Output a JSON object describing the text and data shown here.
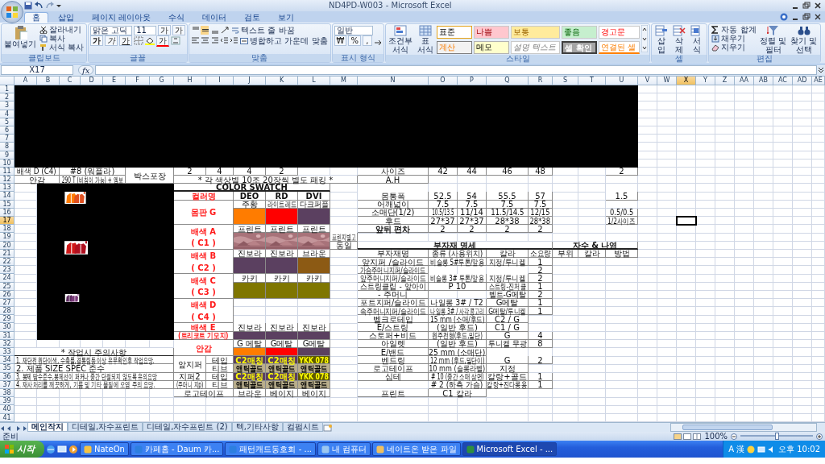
{
  "window": {
    "title": "ND4PD-W003 - Microsoft Excel"
  },
  "ribbon_tabs": [
    {
      "label": "홈",
      "selected": true
    },
    {
      "label": "삽입",
      "selected": false
    },
    {
      "label": "페이지 레이아웃",
      "selected": false
    },
    {
      "label": "수식",
      "selected": false
    },
    {
      "label": "데이터",
      "selected": false
    },
    {
      "label": "검토",
      "selected": false
    },
    {
      "label": "보기",
      "selected": false
    }
  ],
  "clipboard": {
    "paste": "붙여넣기",
    "items": [
      "잘라내기",
      "복사",
      "서식 복사"
    ],
    "label": "클립보드"
  },
  "font": {
    "name": "맑은 고딕",
    "size": "11",
    "grow": "가",
    "shrink": "가",
    "styles": [
      "가",
      "가",
      "가"
    ],
    "color_button": "가",
    "label": "글꼴"
  },
  "alignment": {
    "wrap": "텍스트 줄 바꿈",
    "merge": "병합하고 가운데 맞춤",
    "label": "맞춤"
  },
  "number": {
    "format": "일반",
    "buttons": [
      "₩",
      "%",
      ","
    ],
    "label": "표시 형식"
  },
  "styles": {
    "conditional": "조건부 서식",
    "table": "표 서식",
    "label": "스타일",
    "cells": [
      {
        "text": "표준",
        "kind": "normal"
      },
      {
        "text": "나쁨",
        "kind": "bad"
      },
      {
        "text": "보통",
        "kind": "neutral"
      },
      {
        "text": "좋음",
        "kind": "good"
      },
      {
        "text": "경고문",
        "kind": "warning"
      },
      {
        "text": "계산",
        "kind": "calc"
      },
      {
        "text": "메모",
        "kind": "note"
      },
      {
        "text": "설명 텍스트",
        "kind": "explanatory"
      },
      {
        "text": "셀 확인",
        "kind": "check"
      },
      {
        "text": "연결된 셀",
        "kind": "linked"
      }
    ]
  },
  "cells_group": {
    "buttons": [
      "삽입",
      "삭제",
      "서식"
    ],
    "label": "셀"
  },
  "editing": {
    "items": [
      "자동 합계",
      "채우기",
      "지우기"
    ],
    "big": [
      "정렬 및 필터",
      "찾기 및 선택"
    ],
    "label": "편집"
  },
  "formula_bar": {
    "name_box": "X17",
    "function_label": "fx"
  },
  "columns": [
    {
      "label": "A",
      "selected": false
    },
    {
      "label": "B",
      "selected": false
    },
    {
      "label": "C",
      "selected": false
    },
    {
      "label": "D",
      "selected": false
    },
    {
      "label": "E",
      "selected": false
    },
    {
      "label": "F",
      "selected": false
    },
    {
      "label": "G",
      "selected": false
    },
    {
      "label": "H",
      "selected": false
    },
    {
      "label": "I",
      "selected": false
    },
    {
      "label": "J",
      "selected": false
    },
    {
      "label": "K",
      "selected": false
    },
    {
      "label": "L",
      "selected": false
    },
    {
      "label": "M",
      "selected": false
    },
    {
      "label": "N",
      "selected": false
    },
    {
      "label": "O",
      "selected": false
    },
    {
      "label": "P",
      "selected": false
    },
    {
      "label": "Q",
      "selected": false
    },
    {
      "label": "R",
      "selected": false
    },
    {
      "label": "S",
      "selected": false
    },
    {
      "label": "T",
      "selected": false
    },
    {
      "label": "U",
      "selected": false
    },
    {
      "label": "V",
      "selected": false
    },
    {
      "label": "W",
      "selected": false
    },
    {
      "label": "X",
      "selected": true
    },
    {
      "label": "Y",
      "selected": false
    },
    {
      "label": "Z",
      "selected": false
    },
    {
      "label": "AA",
      "selected": false
    },
    {
      "label": "AB",
      "selected": false
    },
    {
      "label": "AC",
      "selected": false
    },
    {
      "label": "AD",
      "selected": false
    },
    {
      "label": "AE",
      "selected": false
    }
  ],
  "rows": [
    {
      "label": "1",
      "selected": false
    },
    {
      "label": "2",
      "selected": false
    },
    {
      "label": "3",
      "selected": false
    },
    {
      "label": "4",
      "selected": false
    },
    {
      "label": "5",
      "selected": false
    },
    {
      "label": "6",
      "selected": false
    },
    {
      "label": "7",
      "selected": false
    },
    {
      "label": "8",
      "selected": false
    },
    {
      "label": "9",
      "selected": false
    },
    {
      "label": "10",
      "selected": false
    },
    {
      "label": "11",
      "selected": false
    },
    {
      "label": "12",
      "selected": false
    },
    {
      "label": "13",
      "selected": false
    },
    {
      "label": "14",
      "selected": false
    },
    {
      "label": "15",
      "selected": false
    },
    {
      "label": "16",
      "selected": false
    },
    {
      "label": "17",
      "selected": true
    },
    {
      "label": "18",
      "selected": false
    },
    {
      "label": "19",
      "selected": false
    },
    {
      "label": "20",
      "selected": false
    },
    {
      "label": "21",
      "selected": false
    },
    {
      "label": "22",
      "selected": false
    },
    {
      "label": "23",
      "selected": false
    },
    {
      "label": "24",
      "selected": false
    },
    {
      "label": "25",
      "selected": false
    },
    {
      "label": "26",
      "selected": false
    },
    {
      "label": "27",
      "selected": false
    },
    {
      "label": "28",
      "selected": false
    },
    {
      "label": "29",
      "selected": false
    },
    {
      "label": "30",
      "selected": false
    },
    {
      "label": "31",
      "selected": false
    },
    {
      "label": "32",
      "selected": false
    },
    {
      "label": "33",
      "selected": false
    },
    {
      "label": "34",
      "selected": false
    },
    {
      "label": "35",
      "selected": false
    },
    {
      "label": "36",
      "selected": false
    },
    {
      "label": "37",
      "selected": false
    },
    {
      "label": "38",
      "selected": false
    },
    {
      "label": "39",
      "selected": false
    },
    {
      "label": "40",
      "selected": false
    },
    {
      "label": "41",
      "selected": false
    }
  ],
  "sheet": {
    "cells": [
      {
        "text": "배색 D (C4)"
      },
      {
        "text": "#8 (워플라)"
      },
      {
        "text": "박스포장"
      },
      {
        "text": "2"
      },
      {
        "text": "4"
      },
      {
        "text": "4"
      },
      {
        "text": "2"
      },
      {
        "text": "안감"
      },
      {
        "text": "290 T (비침이 가능) + 엠보"
      },
      {
        "text": "* 각 색상별 10조 20장씩 별도 패킹 *"
      },
      {
        "text": "사이즈"
      },
      {
        "text": "42"
      },
      {
        "text": "44"
      },
      {
        "text": "46"
      },
      {
        "text": "48"
      },
      {
        "text": "2"
      },
      {
        "text": "A.H"
      },
      {
        "text": "몸통폭"
      },
      {
        "text": "52.5"
      },
      {
        "text": "54"
      },
      {
        "text": "55.5"
      },
      {
        "text": "57"
      },
      {
        "text": "1.5"
      },
      {
        "text": "어깨넓이"
      },
      {
        "text": "7.5"
      },
      {
        "text": "7.5"
      },
      {
        "text": "7.5"
      },
      {
        "text": "7.5"
      },
      {
        "text": "소매단(1/2)"
      },
      {
        "text": "10.5/13.5"
      },
      {
        "text": "11/14"
      },
      {
        "text": "11.5/14.5"
      },
      {
        "text": "12/15"
      },
      {
        "text": "0.5/0.5"
      },
      {
        "text": "후드"
      },
      {
        "text": "27*37"
      },
      {
        "text": "27*37"
      },
      {
        "text": "28*38"
      },
      {
        "text": "28*38"
      },
      {
        "text": "1/2사이즈"
      },
      {
        "text": "앞뒤 편차"
      },
      {
        "text": "2"
      },
      {
        "text": "2"
      },
      {
        "text": "2"
      },
      {
        "text": "2"
      },
      {
        "text": "COLOR SWATCH"
      },
      {
        "text": "컬러명"
      },
      {
        "text": "DEO"
      },
      {
        "text": "RD"
      },
      {
        "text": "DVI"
      },
      {
        "text": "몸판 G"
      },
      {
        "text": "주황"
      },
      {
        "text": "라이트레드"
      },
      {
        "text": "다크퍼플"
      },
      {
        "color": "#ff7c00"
      },
      {
        "color": "#ff0000"
      },
      {
        "color": "#5b4060"
      },
      {
        "lines": [
          "배색 A",
          "( C1 )"
        ]
      },
      {
        "text": "프린트"
      },
      {
        "text": "프린트"
      },
      {
        "text": "프린트"
      },
      {
        "kind": "picture"
      },
      {
        "kind": "picture"
      },
      {
        "kind": "picture"
      },
      {
        "text": "프린지별고"
      },
      {
        "text": "동일"
      },
      {
        "lines": [
          "배색 B",
          "( C2 )"
        ]
      },
      {
        "text": "진보라"
      },
      {
        "text": "진보라"
      },
      {
        "text": "브라운"
      },
      {
        "color": "#5b4060"
      },
      {
        "color": "#5b4060"
      },
      {
        "color": "#8c5a14"
      },
      {
        "lines": [
          "배색 C",
          "( C3 )"
        ]
      },
      {
        "text": "카키"
      },
      {
        "text": "카키"
      },
      {
        "text": "카키"
      },
      {
        "color": "#7f7600"
      },
      {
        "color": "#7f7600"
      },
      {
        "color": "#7f7600"
      },
      {
        "lines": [
          "배색 D",
          "( C4 )"
        ]
      },
      {
        "text": "배색 E"
      },
      {
        "text": "(트리코트 기모지)"
      },
      {
        "text": "진보라"
      },
      {
        "text": "진보라"
      },
      {
        "text": "진보라"
      },
      {
        "color": "#5b4060"
      },
      {
        "color": "#5b4060"
      },
      {
        "color": "#5b4060"
      },
      {
        "text": "안감"
      },
      {
        "text": "G 메탈"
      },
      {
        "text": "G메탈"
      },
      {
        "text": "G메탈"
      },
      {
        "color": "#ff7c00"
      },
      {
        "color": "#ff0000"
      },
      {
        "color": "#5b4060"
      },
      {
        "text": "앞지퍼"
      },
      {
        "text": "테입"
      },
      {
        "text": "C2매칭",
        "color": "#5b4060"
      },
      {
        "text": "C2매칭",
        "color": "#5b4060"
      },
      {
        "text": "YKK 078",
        "color": "#5f5a00"
      },
      {
        "text": "티브"
      },
      {
        "text": "앤틱골드",
        "color": "#b9ae8c"
      },
      {
        "text": "앤틱골드",
        "color": "#b9ae8c"
      },
      {
        "text": "앤틱골드",
        "color": "#b9ae8c"
      },
      {
        "text": "지퍼2"
      },
      {
        "text": "테입"
      },
      {
        "text": "C2매칭",
        "color": "#5b4060"
      },
      {
        "text": "C2매칭",
        "color": "#5b4060"
      },
      {
        "text": "YKK 078",
        "color": "#5f5a00"
      },
      {
        "text": "(주머니 지p)"
      },
      {
        "text": "티브"
      },
      {
        "text": "앤틱골드",
        "color": "#b9ae8c"
      },
      {
        "text": "앤틱골드",
        "color": "#b9ae8c"
      },
      {
        "text": "앤틱골드",
        "color": "#b9ae8c"
      },
      {
        "text": "로고테이프"
      },
      {
        "text": "브라운"
      },
      {
        "text": "베이지"
      },
      {
        "text": "베이지"
      },
      {
        "text": "* 작업시 주의사항"
      },
      {
        "text": "1. 재단전 원단이색, 수축률,결통림등 이상 유무확인후 작업요망."
      },
      {
        "text": "2. 제품 SIZE SPEC 준수"
      },
      {
        "text": "3. 봉제 땀수준수,봉제선이 퍼커나 중간 단절되지 않도록 유의요망"
      },
      {
        "text": "4. 재사처리를 깨끗하게, 기름 및 기타 물질에 오염 주의 요망."
      },
      {
        "text": "부자재 명세"
      },
      {
        "text": "자수 & 나염"
      },
      {
        "text": "부자재명"
      },
      {
        "text": "종류 (사용위치)"
      },
      {
        "text": "칼라"
      },
      {
        "text": "소요량"
      },
      {
        "text": "부위"
      },
      {
        "text": "칼라"
      },
      {
        "text": "방법"
      }
    ]
  },
  "accessories": [
    {
      "name": "앞지퍼 /슬라이드",
      "type": "비슬롱 5#투톤/앞용",
      "color_name": "지정/투니켈",
      "qty": "1"
    },
    {
      "name": "가슴주머니지퍼/슬라이드",
      "qty": "2"
    },
    {
      "name": "앞주머니지퍼/슬라이드",
      "type": "비슬롱 3# 투톤/앞용",
      "color_name": "지정/투니켈",
      "qty": "2"
    },
    {
      "name": "스트링클립 - 앞아이",
      "type": "P 10",
      "color_name": "스트링-진저클",
      "qty": "1"
    },
    {
      "name": "- 주머니",
      "color_name": "벨트-G메탈",
      "qty": "2"
    },
    {
      "name": "포트지퍼/슬라이드",
      "type": "나일롱 3# / T2",
      "color_name": "G메탈",
      "qty": "1"
    },
    {
      "name": "속주머니지퍼/슬라이드",
      "type": "나일롱 3# / 사각콩고리",
      "color_name": "G메탈/투니켈",
      "qty": "1"
    },
    {
      "name": "벨크로테입",
      "type": "15 mm (소매/후드)",
      "color_name": "C2 / G"
    },
    {
      "name": "E/스트링",
      "type": "(일반 후드)",
      "color_name": "C1 / G"
    },
    {
      "name": "스토퍼+비드",
      "type": "원주전형(후드,밑단)",
      "color_name": "G",
      "qty": "4"
    },
    {
      "name": "아일렛",
      "type": "(일반 후드)",
      "color_name": "투니켈 무광",
      "qty": "8"
    },
    {
      "name": "E/밴드",
      "type": "25 mm (소매단)"
    },
    {
      "name": "벤드링",
      "type": "12 mm (후드,밑단이)",
      "color_name": "G",
      "qty": "2"
    },
    {
      "name": "로고테이프",
      "type": "10 mm (슬롱라벨)",
      "color_name": "지정"
    },
    {
      "name": "심테",
      "type": "# 10 (중간 소매 삼면)",
      "color_name": "칼랑+골드",
      "qty": "1"
    },
    {
      "type": "# 2 (하측 가슴)",
      "color_name": "칼랑+진다롱용",
      "qty": "1"
    },
    {
      "name": "프린트",
      "type": "C1 칼라"
    }
  ],
  "sheet_tabs": [
    {
      "label": "메인작지",
      "selected": true
    },
    {
      "label": "디테일,자수프린트",
      "selected": false
    },
    {
      "label": "디테일,자수프린트 (2)",
      "selected": false
    },
    {
      "label": "텍,기타사항",
      "selected": false
    },
    {
      "label": "컴펌시트",
      "selected": false
    }
  ],
  "status_bar": {
    "status": "준비",
    "zoom": "100%",
    "zoom_slider": {
      "level": 0.5
    }
  },
  "taskbar": {
    "start": "시작",
    "tasks": [
      {
        "label": "NateOn",
        "selected": false
      },
      {
        "label": "카페홈 - Daum 카...",
        "selected": false
      },
      {
        "label": "패턴캐드동호회 - ...",
        "selected": false
      },
      {
        "label": "내 컴퓨터",
        "selected": false
      },
      {
        "label": "네이트온 받은 파일",
        "selected": false
      },
      {
        "label": "Microsoft Excel - ...",
        "selected": true
      }
    ],
    "tray": [
      "A",
      "漢"
    ],
    "clock": "오후 10:02"
  }
}
